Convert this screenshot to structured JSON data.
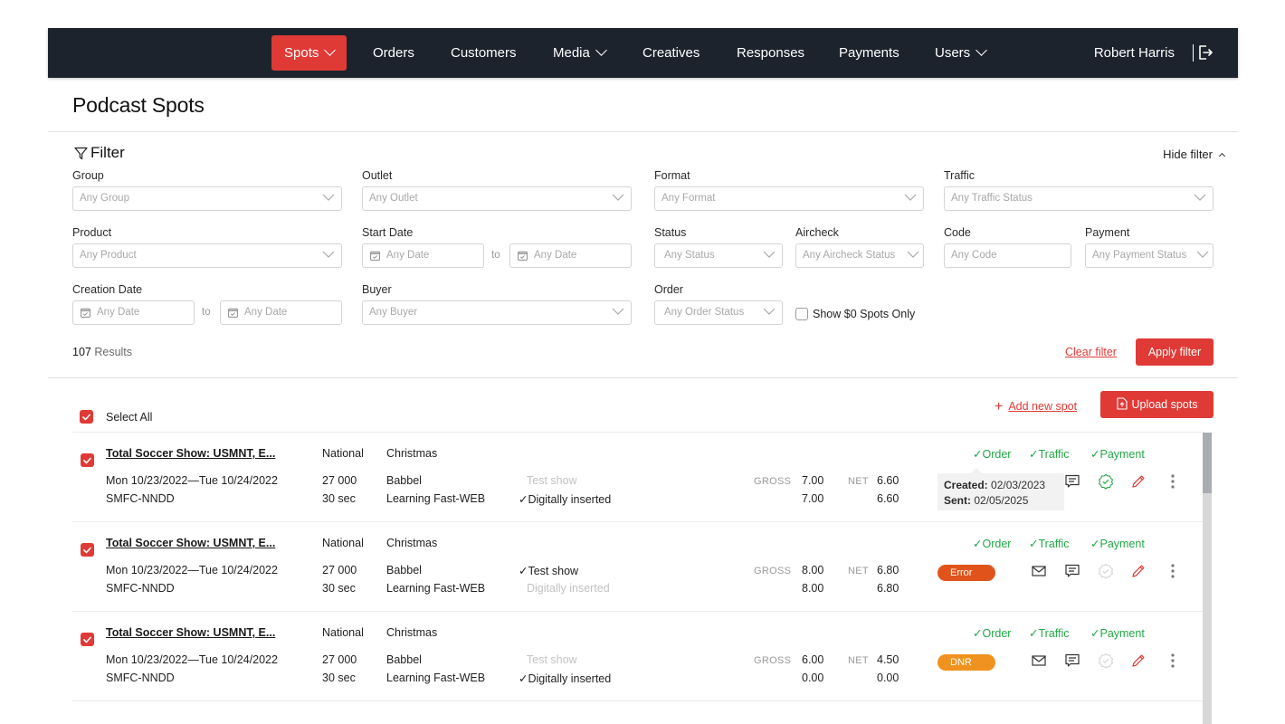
{
  "nav": {
    "items": [
      {
        "label": "Spots",
        "has_dropdown": true,
        "active": true
      },
      {
        "label": "Orders",
        "has_dropdown": false
      },
      {
        "label": "Customers",
        "has_dropdown": false
      },
      {
        "label": "Media",
        "has_dropdown": true
      },
      {
        "label": "Creatives",
        "has_dropdown": false
      },
      {
        "label": "Responses",
        "has_dropdown": false
      },
      {
        "label": "Payments",
        "has_dropdown": false
      },
      {
        "label": "Users",
        "has_dropdown": true
      }
    ],
    "user_name": "Robert Harris",
    "logout_icon": "logout-icon"
  },
  "page": {
    "title": "Podcast Spots"
  },
  "filter": {
    "heading": "Filter",
    "hide_label": "Hide filter",
    "fields": {
      "group": {
        "label": "Group",
        "placeholder": "Any Group"
      },
      "outlet": {
        "label": "Outlet",
        "placeholder": "Any Outlet"
      },
      "format": {
        "label": "Format",
        "placeholder": "Any Format"
      },
      "traffic": {
        "label": "Traffic",
        "placeholder": "Any Traffic Status"
      },
      "product": {
        "label": "Product",
        "placeholder": "Any Product"
      },
      "start_date": {
        "label": "Start Date",
        "from_placeholder": "Any Date",
        "to_label": "to",
        "to_placeholder": "Any Date"
      },
      "status": {
        "label": "Status",
        "placeholder": "Any Status"
      },
      "aircheck": {
        "label": "Aircheck",
        "placeholder": "Any Aircheck Status"
      },
      "code": {
        "label": "Code",
        "placeholder": "Any Code"
      },
      "payment": {
        "label": "Payment",
        "placeholder": "Any Payment Status"
      },
      "creation_date": {
        "label": "Creation Date",
        "from_placeholder": "Any Date",
        "to_label": "to",
        "to_placeholder": "Any Date"
      },
      "buyer": {
        "label": "Buyer",
        "placeholder": "Any Buyer"
      },
      "order": {
        "label": "Order",
        "placeholder": "Any Order Status"
      }
    },
    "show_zero_label": "Show $0 Spots Only",
    "show_zero_checked": false,
    "results_count": "107",
    "results_label": "Results",
    "clear_label": "Clear filter",
    "apply_label": "Apply filter"
  },
  "list": {
    "select_all_label": "Select All",
    "select_all_checked": true,
    "add_new_label": "Add new spot",
    "upload_label": "Upload spots",
    "gross_label": "GROSS",
    "net_label": "NET",
    "rows": [
      {
        "checked": true,
        "title": "Total Soccer Show: USMNT, E...",
        "type": "National",
        "campaign": "Christmas",
        "dates": "Mon 10/23/2022—Tue 10/24/2022",
        "code": "SMFC-NNDD",
        "impressions": "27 000",
        "duration": "30 sec",
        "advertiser": "Babbel",
        "product": "Learning Fast-WEB",
        "test_show": "Test show",
        "test_show_checked": false,
        "digital": "Digitally inserted",
        "digital_checked": true,
        "gross_1": "7.00",
        "gross_2": "7.00",
        "net_1": "6.60",
        "net_2": "6.60",
        "flags": [
          "Order",
          "Traffic",
          "Payment"
        ],
        "tooltip": {
          "created_label": "Created:",
          "created": "02/03/2023",
          "sent_label": "Sent:",
          "sent": "02/05/2025"
        },
        "status_badge": null,
        "verified_active": true
      },
      {
        "checked": true,
        "title": "Total Soccer Show: USMNT, E...",
        "type": "National",
        "campaign": "Christmas",
        "dates": "Mon 10/23/2022—Tue 10/24/2022",
        "code": "SMFC-NNDD",
        "impressions": "27 000",
        "duration": "30 sec",
        "advertiser": "Babbel",
        "product": "Learning Fast-WEB",
        "test_show": "Test show",
        "test_show_checked": true,
        "digital": "Digitally inserted",
        "digital_checked": false,
        "gross_1": "8.00",
        "gross_2": "8.00",
        "net_1": "6.80",
        "net_2": "6.80",
        "flags": [
          "Order",
          "Traffic",
          "Payment"
        ],
        "status_badge": {
          "label": "Error",
          "color": "#e0531a"
        },
        "verified_active": false
      },
      {
        "checked": true,
        "title": "Total Soccer Show: USMNT, E...",
        "type": "National",
        "campaign": "Christmas",
        "dates": "Mon 10/23/2022—Tue 10/24/2022",
        "code": "SMFC-NNDD",
        "impressions": "27 000",
        "duration": "30 sec",
        "advertiser": "Babbel",
        "product": "Learning Fast-WEB",
        "test_show": "Test show",
        "test_show_checked": false,
        "digital": "Digitally inserted",
        "digital_checked": true,
        "gross_1": "6.00",
        "gross_2": "0.00",
        "net_1": "4.50",
        "net_2": "0.00",
        "flags": [
          "Order",
          "Traffic",
          "Payment"
        ],
        "status_badge": {
          "label": "DNR",
          "color": "#f0921f"
        },
        "verified_active": false
      }
    ]
  },
  "colors": {
    "brand_red": "#e03a36",
    "nav_bg": "#1c232d",
    "success_green": "#22a847",
    "error_orange": "#e0531a",
    "dnr_orange": "#f0921f"
  }
}
